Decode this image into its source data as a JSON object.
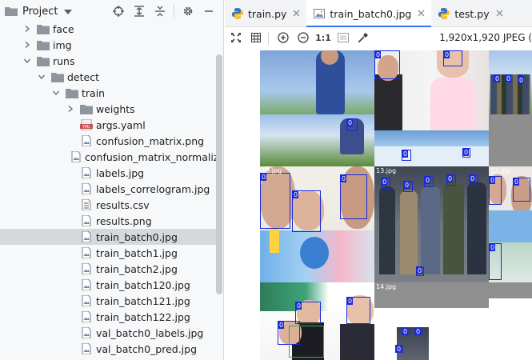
{
  "project": {
    "title": "Project"
  },
  "tree": [
    {
      "label": "face",
      "type": "folder",
      "depth": 1,
      "expanded": false
    },
    {
      "label": "img",
      "type": "folder",
      "depth": 1,
      "expanded": false
    },
    {
      "label": "runs",
      "type": "folder",
      "depth": 1,
      "expanded": true
    },
    {
      "label": "detect",
      "type": "folder",
      "depth": 2,
      "expanded": true
    },
    {
      "label": "train",
      "type": "folder",
      "depth": 3,
      "expanded": true
    },
    {
      "label": "weights",
      "type": "folder",
      "depth": 4,
      "expanded": false
    },
    {
      "label": "args.yaml",
      "type": "yaml",
      "depth": 4
    },
    {
      "label": "confusion_matrix.png",
      "type": "image",
      "depth": 4
    },
    {
      "label": "confusion_matrix_normalized.png",
      "type": "image",
      "depth": 4
    },
    {
      "label": "labels.jpg",
      "type": "image",
      "depth": 4
    },
    {
      "label": "labels_correlogram.jpg",
      "type": "image",
      "depth": 4
    },
    {
      "label": "results.csv",
      "type": "csv",
      "depth": 4
    },
    {
      "label": "results.png",
      "type": "image",
      "depth": 4
    },
    {
      "label": "train_batch0.jpg",
      "type": "image",
      "depth": 4,
      "selected": true
    },
    {
      "label": "train_batch1.jpg",
      "type": "image",
      "depth": 4
    },
    {
      "label": "train_batch2.jpg",
      "type": "image",
      "depth": 4
    },
    {
      "label": "train_batch120.jpg",
      "type": "image",
      "depth": 4
    },
    {
      "label": "train_batch121.jpg",
      "type": "image",
      "depth": 4
    },
    {
      "label": "train_batch122.jpg",
      "type": "image",
      "depth": 4
    },
    {
      "label": "val_batch0_labels.jpg",
      "type": "image",
      "depth": 4
    },
    {
      "label": "val_batch0_pred.jpg",
      "type": "image",
      "depth": 4
    }
  ],
  "tabs": [
    {
      "label": "train.py",
      "type": "python",
      "active": false
    },
    {
      "label": "train_batch0.jpg",
      "type": "image",
      "active": true
    },
    {
      "label": "test.py",
      "type": "python",
      "active": false
    }
  ],
  "image_toolbar": {
    "actual_size_label": "1:1"
  },
  "image_info": "1,920x1,920 JPEG (",
  "mosaic": {
    "tile_labels": [
      "18.jpg",
      "13.jpg",
      "12.jpg",
      "14.jpg"
    ],
    "box_class": "0"
  },
  "colors": {
    "accent": "#3574f0",
    "selection": "#d5d9de",
    "box": "#1a2ad8",
    "folder": "#8f959e"
  }
}
